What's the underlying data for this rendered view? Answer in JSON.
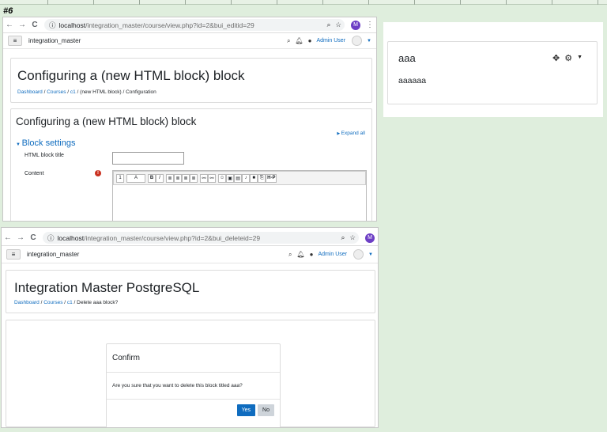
{
  "step_label": "#6",
  "top_window": {
    "url_host": "localhost",
    "url_path": "/integration_master/course/view.php?id=2&bui_editid=29",
    "profile_initial": "M",
    "site_name": "integration_master",
    "user_name": "Admin User",
    "page_heading": "Configuring a (new HTML block) block",
    "breadcrumb": [
      "Dashboard",
      "Courses",
      "c1",
      "(new HTML block)",
      "Configuration"
    ],
    "form_heading": "Configuring a (new HTML block) block",
    "expand_all": "Expand all",
    "section_title": "Block settings",
    "title_label": "HTML block title",
    "title_value": "",
    "content_label": "Content",
    "toolbar_items": [
      "1",
      "A",
      "B",
      "I",
      "≣",
      "≣",
      "≣",
      "≣",
      "⚯",
      "⚯",
      "☺",
      "▣",
      "▤",
      "♪",
      "■",
      "⎘",
      "H-P"
    ]
  },
  "block_preview": {
    "title": "aaa",
    "body": "aaaaaa"
  },
  "bottom_window": {
    "url_host": "localhost",
    "url_path": "/integration_master/course/view.php?id=2&bui_deleteid=29",
    "profile_initial": "M",
    "site_name": "integration_master",
    "user_name": "Admin User",
    "page_heading": "Integration Master PostgreSQL",
    "breadcrumb": [
      "Dashboard",
      "Courses",
      "c1",
      "Delete aaa block?"
    ],
    "dialog": {
      "title": "Confirm",
      "message": "Are you sure that you want to delete this block titled aaa?",
      "yes_label": "Yes",
      "no_label": "No"
    }
  },
  "colors": {
    "background": "#dfeedd",
    "link": "#0f6cbf",
    "primary_button": "#0f6cbf",
    "profile_avatar": "#6d3fc5",
    "required_icon": "#ca3120"
  }
}
